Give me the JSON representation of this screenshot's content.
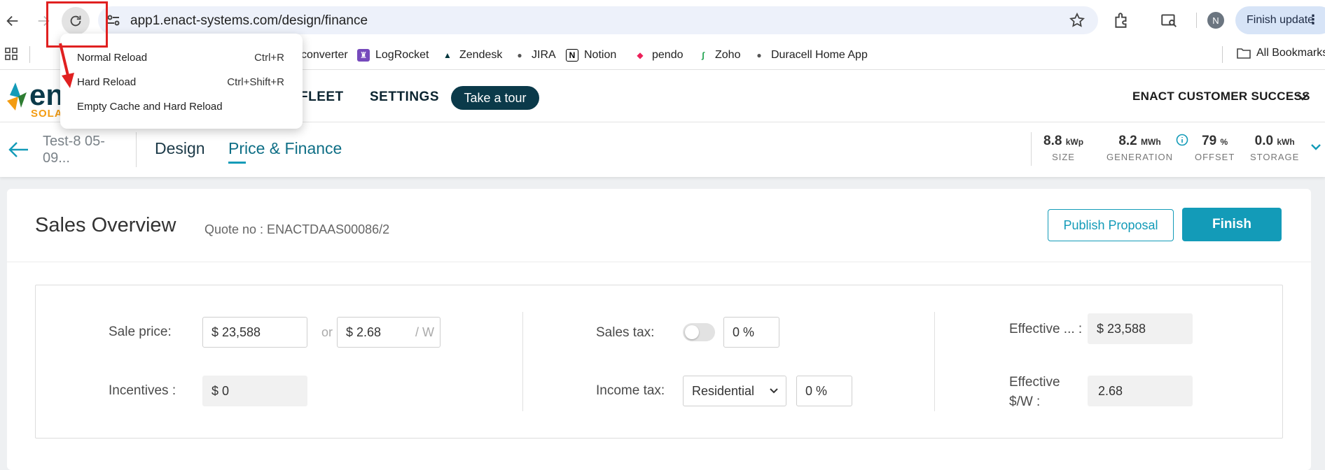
{
  "browser": {
    "url": "app1.enact-systems.com/design/finance",
    "profile_initial": "N",
    "update_label": "Finish update",
    "update_dots": "⋮"
  },
  "bookmarks": {
    "items": [
      {
        "label": "converter",
        "fav": "",
        "color": "#ffffff"
      },
      {
        "label": "LogRocket",
        "fav": "♜",
        "color": "#764abc"
      },
      {
        "label": "Zendesk",
        "fav": "▲",
        "color": "#03363d"
      },
      {
        "label": "JIRA",
        "fav": "●",
        "color": "#555555"
      },
      {
        "label": "Notion",
        "fav": "N",
        "color": "#000000"
      },
      {
        "label": "pendo",
        "fav": "◆",
        "color": "#ec2059"
      },
      {
        "label": "Zoho",
        "fav": "∫",
        "color": "#18a049"
      },
      {
        "label": "Duracell Home App",
        "fav": "●",
        "color": "#555555"
      }
    ],
    "all_label": "All Bookmarks"
  },
  "context_menu": {
    "items": [
      {
        "label": "Normal Reload",
        "shortcut": "Ctrl+R"
      },
      {
        "label": "Hard Reload",
        "shortcut": "Ctrl+Shift+R"
      },
      {
        "label": "Empty Cache and Hard Reload",
        "shortcut": ""
      }
    ]
  },
  "header": {
    "logo_text": "en",
    "logo_sub": "SOLA",
    "nav": [
      "FLEET",
      "SETTINGS"
    ],
    "tour_label": "Take a tour",
    "account_label": "ENACT CUSTOMER SUCCESS"
  },
  "subheader": {
    "project_name": "Test-8 05-09...",
    "tabs": [
      "Design",
      "Price & Finance"
    ],
    "active_tab": "Price & Finance",
    "stats": [
      {
        "value": "8.8",
        "unit": "kWp",
        "label": "SIZE"
      },
      {
        "value": "8.2",
        "unit": "MWh",
        "label": "GENERATION"
      },
      {
        "value": "79",
        "unit": "%",
        "label": "OFFSET"
      },
      {
        "value": "0.0",
        "unit": "kWh",
        "label": "STORAGE"
      }
    ]
  },
  "main": {
    "title": "Sales Overview",
    "quote": "Quote no : ENACTDAAS00086/2",
    "publish_label": "Publish Proposal",
    "finish_label": "Finish",
    "sale_price_label": "Sale price:",
    "sale_price_value": "$  23,588",
    "or_label": "or",
    "per_watt_value": "$  2.68",
    "per_watt_unit": "/ W",
    "incentives_label": "Incentives :",
    "incentives_value": "$ 0",
    "sales_tax_label": "Sales tax:",
    "sales_tax_value": "0 %",
    "income_tax_label": "Income tax:",
    "income_tax_type": "Residential",
    "income_tax_value": "0 %",
    "effective_label": "Effective ... :",
    "effective_value": "$ 23,588",
    "effective_w_label_1": "Effective",
    "effective_w_label_2": "$/W :",
    "effective_w_value": "2.68"
  },
  "colors": {
    "accent": "#139bb8",
    "brand_dark": "#0b3a4a",
    "brand_orange": "#f39c12",
    "annotation_red": "#e02020"
  }
}
